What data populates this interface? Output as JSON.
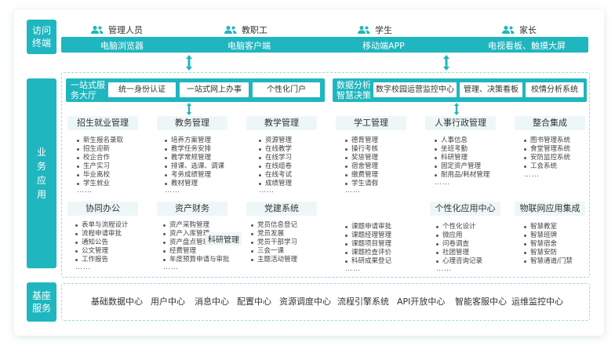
{
  "sections": {
    "access": "访问终端",
    "business": "业务应用",
    "base": "基座服务"
  },
  "roles": [
    "管理人员",
    "教职工",
    "学生",
    "家长"
  ],
  "terminals": [
    "电脑浏览器",
    "电脑客户端",
    "移动端APP",
    "电视看板、触摸大屏"
  ],
  "portal_left": {
    "title": "一站式服务大厅",
    "items": [
      "统一身份认证",
      "一站式网上办事",
      "个性化门户"
    ]
  },
  "portal_right": {
    "title": "数据分析智慧决策",
    "items": [
      "数字校园运营监控中心",
      "管理、决策看板",
      "校情分析系统"
    ]
  },
  "modules_top": [
    {
      "title": "招生就业管理",
      "items": [
        "新生报名录取",
        "招生迎新",
        "校企合作",
        "生产实习",
        "毕业离校",
        "学生就业"
      ]
    },
    {
      "title": "教务管理",
      "items": [
        "培养方案管理",
        "教学任务安排",
        "教学常规管理",
        "排课、选课、调课",
        "考务成绩管理",
        "教材管理"
      ]
    },
    {
      "title": "教学管理",
      "items": [
        "资源管理",
        "在线教学",
        "在线学习",
        "在线组卷",
        "在线考试",
        "成绩管理"
      ]
    },
    {
      "title": "学工管理",
      "items": [
        "德育管理",
        "操行考核",
        "奖惩管理",
        "宿舍管理",
        "缴费管理",
        "学生请假"
      ]
    },
    {
      "title": "人事行政管理",
      "items": [
        "人事信息",
        "坐班考勤",
        "科研管理",
        "固定资产管理",
        "耐用品/耗材管理"
      ]
    },
    {
      "title": "整合集成",
      "items": [
        "图书管理系统",
        "食堂管理系统",
        "安防监控系统",
        "工会系统"
      ]
    }
  ],
  "modules_bottom": [
    {
      "title": "协同办公",
      "items": [
        "表单与流程设计",
        "流程申请审批",
        "通知公告",
        "公文管理",
        "工作报告"
      ]
    },
    {
      "title": "资产财务",
      "items": [
        "资产采购管理",
        "资产入库管理",
        "资产盘点管理",
        "经费管理",
        "年度预算申请与审批"
      ]
    },
    {
      "title": "党建系统",
      "items": [
        "党员信息登记",
        "党员发展",
        "党员干部学习",
        "三会一课",
        "主题活动管理"
      ]
    },
    {
      "title": "科研管理",
      "items": [
        "课题申请审批",
        "课题经理管理",
        "课题项目管理",
        "课题检查评价",
        "科研成果登记"
      ]
    },
    {
      "title": "个性化应用中心",
      "items": [
        "个性化设计",
        "微应用",
        "问卷调查",
        "社团管理",
        "心理咨询记录"
      ]
    },
    {
      "title": "物联网应用集成",
      "items": [
        "智慧教室",
        "智慧班牌",
        "智慧宿舍",
        "智慧安防",
        "智慧通道/门禁"
      ]
    }
  ],
  "ellipsis": "……",
  "base_services": [
    "基础数据中心",
    "用户中心",
    "消息中心",
    "配置中心",
    "资源调度中心",
    "流程引擎系统",
    "API开放中心",
    "智能客服中心",
    "运维监控中心"
  ],
  "colors": {
    "accent": "#1fb6bf",
    "module_bg": "#eef7f8"
  }
}
